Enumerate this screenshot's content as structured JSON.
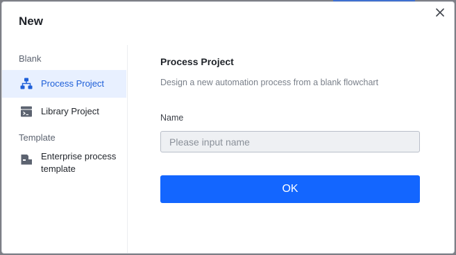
{
  "dialog": {
    "title": "New",
    "close_icon": "close-icon"
  },
  "sidebar": {
    "sections": [
      {
        "label": "Blank",
        "items": [
          {
            "label": "Process Project",
            "icon": "flowchart-icon",
            "active": true
          },
          {
            "label": "Library Project",
            "icon": "library-icon",
            "active": false
          }
        ]
      },
      {
        "label": "Template",
        "items": [
          {
            "label": "Enterprise process template",
            "icon": "template-icon",
            "active": false
          }
        ]
      }
    ]
  },
  "main": {
    "title": "Process Project",
    "description": "Design a new automation process from a blank flowchart",
    "name_label": "Name",
    "name_value": "",
    "name_placeholder": "Please input name",
    "ok_label": "OK"
  },
  "colors": {
    "accent": "#1366ff",
    "active_bg": "#e8f0ff",
    "active_text": "#1e5fd8"
  }
}
